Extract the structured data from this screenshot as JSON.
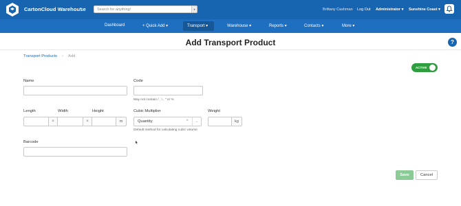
{
  "header": {
    "app_name": "CartonCloud Warehouse",
    "app_caret": "▾",
    "search_placeholder": "Search for anything!",
    "search_btn": "▾",
    "user_name": "Brittany Cashman",
    "logout": "Log Out",
    "role": "Administrator ▾",
    "location": "Sunshine Coast ▾"
  },
  "nav": {
    "items": [
      "Dashboard",
      "+ Quick Add ▾",
      "Transport ▾",
      "Warehouse ▾",
      "Reports ▾",
      "Contacts ▾",
      "More ▾"
    ],
    "active": "Transport ▾"
  },
  "page": {
    "title": "Add Transport Product",
    "help": "?",
    "breadcrumb_link": "Transport Products",
    "breadcrumb_sep": "›",
    "breadcrumb_current": "Add"
  },
  "form": {
    "active_toggle": "ACTIVE",
    "name_label": "Name",
    "name_value": "",
    "code_label": "Code",
    "code_value": "",
    "code_hint": "May not contain / , \\ , \" or %",
    "length_label": "Length",
    "width_label": "Width",
    "height_label": "Height",
    "dim_separator": "×",
    "dim_unit": "m",
    "cubic_label": "Cubic Multiplier",
    "cubic_value": "Quantity",
    "cubic_clear": "×",
    "cubic_caret": "⌄",
    "cubic_hint": "Default method for calculating cubic volume",
    "weight_label": "Weight",
    "weight_unit": "kg",
    "barcode_label": "Barcode",
    "barcode_value": ""
  },
  "actions": {
    "save": "Save",
    "cancel": "Cancel"
  },
  "colors": {
    "topbar": "#1765b0",
    "navbar": "#1e6fc0",
    "toggle_active": "#2e9e3f",
    "save_disabled": "#8bcb95"
  }
}
